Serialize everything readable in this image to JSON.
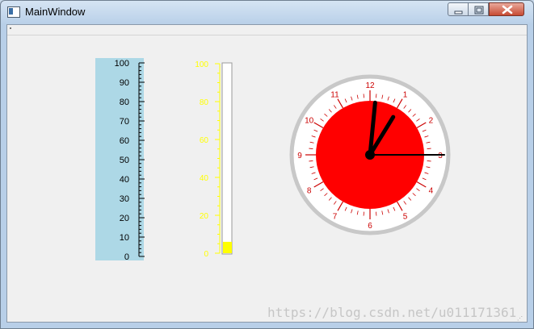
{
  "window": {
    "title": "MainWindow",
    "buttons": {
      "minimize": "minimize",
      "maximize": "maximize",
      "close": "close"
    }
  },
  "thermometer": {
    "min": 0,
    "max": 100,
    "tick_labels": [
      "100",
      "90",
      "80",
      "70",
      "60",
      "50",
      "40",
      "30",
      "20",
      "10",
      "0"
    ],
    "bg_color": "#add8e6",
    "tick_color": "#000000"
  },
  "level_gauge": {
    "min": 0,
    "max": 100,
    "tick_labels": [
      "100",
      "80",
      "60",
      "40",
      "20",
      "0"
    ],
    "value": 6,
    "color": "#ffff00"
  },
  "clock": {
    "numbers": [
      "12",
      "1",
      "2",
      "3",
      "4",
      "5",
      "6",
      "7",
      "8",
      "9",
      "10",
      "11"
    ],
    "hour": 12,
    "minute": 5,
    "second": 15,
    "face_color": "#ff0000",
    "number_color": "#cc0000",
    "ring_color": "#c8c8c8",
    "hand_color": "#000000"
  },
  "watermark": "https://blog.csdn.net/u011171361"
}
